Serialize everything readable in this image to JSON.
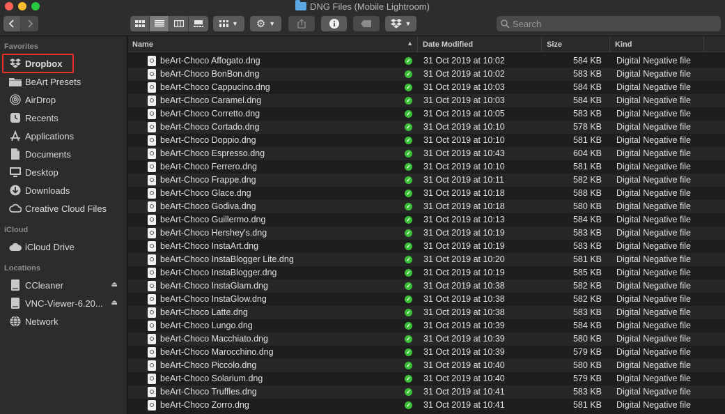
{
  "window": {
    "title": "DNG Files (Mobile Lightroom)"
  },
  "toolbar": {
    "view_icons": [
      "icon-view-icon",
      "list-view-icon",
      "column-view-icon",
      "gallery-view-icon"
    ],
    "search_placeholder": "Search"
  },
  "sidebar": {
    "favorites_label": "Favorites",
    "favorites": [
      {
        "label": "Dropbox",
        "icon": "dropbox-icon"
      },
      {
        "label": "BeArt Presets",
        "icon": "folder-icon"
      },
      {
        "label": "AirDrop",
        "icon": "airdrop-icon"
      },
      {
        "label": "Recents",
        "icon": "clock-icon"
      },
      {
        "label": "Applications",
        "icon": "applications-icon"
      },
      {
        "label": "Documents",
        "icon": "document-icon"
      },
      {
        "label": "Desktop",
        "icon": "desktop-icon"
      },
      {
        "label": "Downloads",
        "icon": "download-icon"
      },
      {
        "label": "Creative Cloud Files",
        "icon": "creative-cloud-icon"
      }
    ],
    "icloud_label": "iCloud",
    "icloud": [
      {
        "label": "iCloud Drive",
        "icon": "cloud-icon"
      }
    ],
    "locations_label": "Locations",
    "locations": [
      {
        "label": "CCleaner",
        "icon": "disk-icon"
      },
      {
        "label": "VNC-Viewer-6.20...",
        "icon": "disk-icon"
      },
      {
        "label": "Network",
        "icon": "globe-icon"
      }
    ]
  },
  "columns": {
    "name": "Name",
    "date": "Date Modified",
    "size": "Size",
    "kind": "Kind"
  },
  "files": [
    {
      "name": "beArt-Choco Affogato.dng",
      "date": "31 Oct 2019 at 10:02",
      "size": "584 KB",
      "kind": "Digital Negative file"
    },
    {
      "name": "beArt-Choco BonBon.dng",
      "date": "31 Oct 2019 at 10:02",
      "size": "583 KB",
      "kind": "Digital Negative file"
    },
    {
      "name": "beArt-Choco Cappucino.dng",
      "date": "31 Oct 2019 at 10:03",
      "size": "584 KB",
      "kind": "Digital Negative file"
    },
    {
      "name": "beArt-Choco Caramel.dng",
      "date": "31 Oct 2019 at 10:03",
      "size": "584 KB",
      "kind": "Digital Negative file"
    },
    {
      "name": "beArt-Choco Corretto.dng",
      "date": "31 Oct 2019 at 10:05",
      "size": "583 KB",
      "kind": "Digital Negative file"
    },
    {
      "name": "beArt-Choco Cortado.dng",
      "date": "31 Oct 2019 at 10:10",
      "size": "578 KB",
      "kind": "Digital Negative file"
    },
    {
      "name": "beArt-Choco Doppio.dng",
      "date": "31 Oct 2019 at 10:10",
      "size": "581 KB",
      "kind": "Digital Negative file"
    },
    {
      "name": "beArt-Choco Espresso.dng",
      "date": "31 Oct 2019 at 10:43",
      "size": "604 KB",
      "kind": "Digital Negative file"
    },
    {
      "name": "beArt-Choco Ferrero.dng",
      "date": "31 Oct 2019 at 10:10",
      "size": "581 KB",
      "kind": "Digital Negative file"
    },
    {
      "name": "beArt-Choco Frappe.dng",
      "date": "31 Oct 2019 at 10:11",
      "size": "582 KB",
      "kind": "Digital Negative file"
    },
    {
      "name": "beArt-Choco Glace.dng",
      "date": "31 Oct 2019 at 10:18",
      "size": "588 KB",
      "kind": "Digital Negative file"
    },
    {
      "name": "beArt-Choco Godiva.dng",
      "date": "31 Oct 2019 at 10:18",
      "size": "580 KB",
      "kind": "Digital Negative file"
    },
    {
      "name": "beArt-Choco Guillermo.dng",
      "date": "31 Oct 2019 at 10:13",
      "size": "584 KB",
      "kind": "Digital Negative file"
    },
    {
      "name": "beArt-Choco Hershey's.dng",
      "date": "31 Oct 2019 at 10:19",
      "size": "583 KB",
      "kind": "Digital Negative file"
    },
    {
      "name": "beArt-Choco InstaArt.dng",
      "date": "31 Oct 2019 at 10:19",
      "size": "583 KB",
      "kind": "Digital Negative file"
    },
    {
      "name": "beArt-Choco InstaBlogger Lite.dng",
      "date": "31 Oct 2019 at 10:20",
      "size": "581 KB",
      "kind": "Digital Negative file"
    },
    {
      "name": "beArt-Choco InstaBlogger.dng",
      "date": "31 Oct 2019 at 10:19",
      "size": "585 KB",
      "kind": "Digital Negative file"
    },
    {
      "name": "beArt-Choco InstaGlam.dng",
      "date": "31 Oct 2019 at 10:38",
      "size": "582 KB",
      "kind": "Digital Negative file"
    },
    {
      "name": "beArt-Choco InstaGlow.dng",
      "date": "31 Oct 2019 at 10:38",
      "size": "582 KB",
      "kind": "Digital Negative file"
    },
    {
      "name": "beArt-Choco Latte.dng",
      "date": "31 Oct 2019 at 10:38",
      "size": "583 KB",
      "kind": "Digital Negative file"
    },
    {
      "name": "beArt-Choco Lungo.dng",
      "date": "31 Oct 2019 at 10:39",
      "size": "584 KB",
      "kind": "Digital Negative file"
    },
    {
      "name": "beArt-Choco Macchiato.dng",
      "date": "31 Oct 2019 at 10:39",
      "size": "580 KB",
      "kind": "Digital Negative file"
    },
    {
      "name": "beArt-Choco Marocchino.dng",
      "date": "31 Oct 2019 at 10:39",
      "size": "579 KB",
      "kind": "Digital Negative file"
    },
    {
      "name": "beArt-Choco Piccolo.dng",
      "date": "31 Oct 2019 at 10:40",
      "size": "580 KB",
      "kind": "Digital Negative file"
    },
    {
      "name": "beArt-Choco Solarium.dng",
      "date": "31 Oct 2019 at 10:40",
      "size": "579 KB",
      "kind": "Digital Negative file"
    },
    {
      "name": "beArt-Choco Truffles.dng",
      "date": "31 Oct 2019 at 10:41",
      "size": "583 KB",
      "kind": "Digital Negative file"
    },
    {
      "name": "beArt-Choco Zorro.dng",
      "date": "31 Oct 2019 at 10:41",
      "size": "581 KB",
      "kind": "Digital Negative file"
    }
  ],
  "colors": {
    "sync_ok": "#3cbf38",
    "highlight": "#e8302a",
    "folder": "#5aa8e6"
  }
}
